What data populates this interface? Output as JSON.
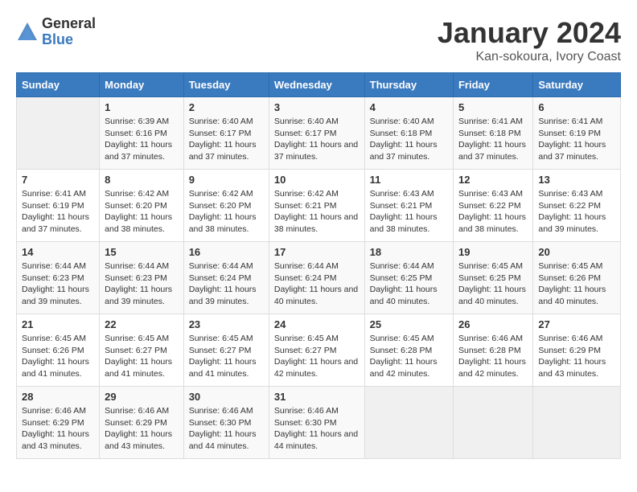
{
  "header": {
    "logo": {
      "general": "General",
      "blue": "Blue"
    },
    "title": "January 2024",
    "subtitle": "Kan-sokoura, Ivory Coast"
  },
  "calendar": {
    "days_of_week": [
      "Sunday",
      "Monday",
      "Tuesday",
      "Wednesday",
      "Thursday",
      "Friday",
      "Saturday"
    ],
    "weeks": [
      [
        {
          "day": "",
          "info": ""
        },
        {
          "day": "1",
          "sunrise": "Sunrise: 6:39 AM",
          "sunset": "Sunset: 6:16 PM",
          "daylight": "Daylight: 11 hours and 37 minutes."
        },
        {
          "day": "2",
          "sunrise": "Sunrise: 6:40 AM",
          "sunset": "Sunset: 6:17 PM",
          "daylight": "Daylight: 11 hours and 37 minutes."
        },
        {
          "day": "3",
          "sunrise": "Sunrise: 6:40 AM",
          "sunset": "Sunset: 6:17 PM",
          "daylight": "Daylight: 11 hours and 37 minutes."
        },
        {
          "day": "4",
          "sunrise": "Sunrise: 6:40 AM",
          "sunset": "Sunset: 6:18 PM",
          "daylight": "Daylight: 11 hours and 37 minutes."
        },
        {
          "day": "5",
          "sunrise": "Sunrise: 6:41 AM",
          "sunset": "Sunset: 6:18 PM",
          "daylight": "Daylight: 11 hours and 37 minutes."
        },
        {
          "day": "6",
          "sunrise": "Sunrise: 6:41 AM",
          "sunset": "Sunset: 6:19 PM",
          "daylight": "Daylight: 11 hours and 37 minutes."
        }
      ],
      [
        {
          "day": "7",
          "sunrise": "Sunrise: 6:41 AM",
          "sunset": "Sunset: 6:19 PM",
          "daylight": "Daylight: 11 hours and 37 minutes."
        },
        {
          "day": "8",
          "sunrise": "Sunrise: 6:42 AM",
          "sunset": "Sunset: 6:20 PM",
          "daylight": "Daylight: 11 hours and 38 minutes."
        },
        {
          "day": "9",
          "sunrise": "Sunrise: 6:42 AM",
          "sunset": "Sunset: 6:20 PM",
          "daylight": "Daylight: 11 hours and 38 minutes."
        },
        {
          "day": "10",
          "sunrise": "Sunrise: 6:42 AM",
          "sunset": "Sunset: 6:21 PM",
          "daylight": "Daylight: 11 hours and 38 minutes."
        },
        {
          "day": "11",
          "sunrise": "Sunrise: 6:43 AM",
          "sunset": "Sunset: 6:21 PM",
          "daylight": "Daylight: 11 hours and 38 minutes."
        },
        {
          "day": "12",
          "sunrise": "Sunrise: 6:43 AM",
          "sunset": "Sunset: 6:22 PM",
          "daylight": "Daylight: 11 hours and 38 minutes."
        },
        {
          "day": "13",
          "sunrise": "Sunrise: 6:43 AM",
          "sunset": "Sunset: 6:22 PM",
          "daylight": "Daylight: 11 hours and 39 minutes."
        }
      ],
      [
        {
          "day": "14",
          "sunrise": "Sunrise: 6:44 AM",
          "sunset": "Sunset: 6:23 PM",
          "daylight": "Daylight: 11 hours and 39 minutes."
        },
        {
          "day": "15",
          "sunrise": "Sunrise: 6:44 AM",
          "sunset": "Sunset: 6:23 PM",
          "daylight": "Daylight: 11 hours and 39 minutes."
        },
        {
          "day": "16",
          "sunrise": "Sunrise: 6:44 AM",
          "sunset": "Sunset: 6:24 PM",
          "daylight": "Daylight: 11 hours and 39 minutes."
        },
        {
          "day": "17",
          "sunrise": "Sunrise: 6:44 AM",
          "sunset": "Sunset: 6:24 PM",
          "daylight": "Daylight: 11 hours and 40 minutes."
        },
        {
          "day": "18",
          "sunrise": "Sunrise: 6:44 AM",
          "sunset": "Sunset: 6:25 PM",
          "daylight": "Daylight: 11 hours and 40 minutes."
        },
        {
          "day": "19",
          "sunrise": "Sunrise: 6:45 AM",
          "sunset": "Sunset: 6:25 PM",
          "daylight": "Daylight: 11 hours and 40 minutes."
        },
        {
          "day": "20",
          "sunrise": "Sunrise: 6:45 AM",
          "sunset": "Sunset: 6:26 PM",
          "daylight": "Daylight: 11 hours and 40 minutes."
        }
      ],
      [
        {
          "day": "21",
          "sunrise": "Sunrise: 6:45 AM",
          "sunset": "Sunset: 6:26 PM",
          "daylight": "Daylight: 11 hours and 41 minutes."
        },
        {
          "day": "22",
          "sunrise": "Sunrise: 6:45 AM",
          "sunset": "Sunset: 6:27 PM",
          "daylight": "Daylight: 11 hours and 41 minutes."
        },
        {
          "day": "23",
          "sunrise": "Sunrise: 6:45 AM",
          "sunset": "Sunset: 6:27 PM",
          "daylight": "Daylight: 11 hours and 41 minutes."
        },
        {
          "day": "24",
          "sunrise": "Sunrise: 6:45 AM",
          "sunset": "Sunset: 6:27 PM",
          "daylight": "Daylight: 11 hours and 42 minutes."
        },
        {
          "day": "25",
          "sunrise": "Sunrise: 6:45 AM",
          "sunset": "Sunset: 6:28 PM",
          "daylight": "Daylight: 11 hours and 42 minutes."
        },
        {
          "day": "26",
          "sunrise": "Sunrise: 6:46 AM",
          "sunset": "Sunset: 6:28 PM",
          "daylight": "Daylight: 11 hours and 42 minutes."
        },
        {
          "day": "27",
          "sunrise": "Sunrise: 6:46 AM",
          "sunset": "Sunset: 6:29 PM",
          "daylight": "Daylight: 11 hours and 43 minutes."
        }
      ],
      [
        {
          "day": "28",
          "sunrise": "Sunrise: 6:46 AM",
          "sunset": "Sunset: 6:29 PM",
          "daylight": "Daylight: 11 hours and 43 minutes."
        },
        {
          "day": "29",
          "sunrise": "Sunrise: 6:46 AM",
          "sunset": "Sunset: 6:29 PM",
          "daylight": "Daylight: 11 hours and 43 minutes."
        },
        {
          "day": "30",
          "sunrise": "Sunrise: 6:46 AM",
          "sunset": "Sunset: 6:30 PM",
          "daylight": "Daylight: 11 hours and 44 minutes."
        },
        {
          "day": "31",
          "sunrise": "Sunrise: 6:46 AM",
          "sunset": "Sunset: 6:30 PM",
          "daylight": "Daylight: 11 hours and 44 minutes."
        },
        {
          "day": "",
          "info": ""
        },
        {
          "day": "",
          "info": ""
        },
        {
          "day": "",
          "info": ""
        }
      ]
    ]
  }
}
